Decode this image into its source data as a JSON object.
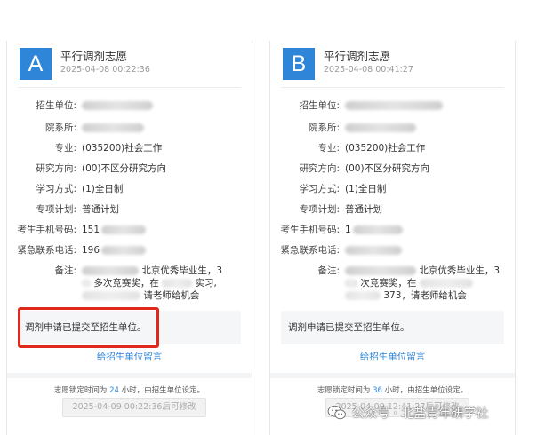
{
  "cards": [
    {
      "letter": "A",
      "title": "平行调剂志愿",
      "time": "2025-04-08 00:22:36",
      "labels": [
        "招生单位:",
        "院系所:",
        "专业:",
        "研究方向:",
        "学习方式:",
        "专项计划:",
        "考生手机号码:",
        "紧急联系电话:",
        "备注:"
      ],
      "major": "(035200)社会工作",
      "direction": "(00)不区分研究方向",
      "study_mode": "(1)全日制",
      "plan": "普通计划",
      "phone_prefix": "151",
      "emergency_prefix": "196",
      "remark_line1": "北京优秀毕业生，3",
      "remark_line2": "多次竞赛奖，在",
      "remark_line2b": "实习,",
      "remark_line3": "请老师给机会",
      "notice": "调剂申请已提交至招生单位。",
      "message_link": "给招生单位留言",
      "lock_prefix": "志愿锁定时间为",
      "lock_hours": "24",
      "lock_suffix": "小时，由招生单位设定。",
      "modify_button": "2025-04-09 00:22:36后可修改"
    },
    {
      "letter": "B",
      "title": "平行调剂志愿",
      "time": "2025-04-08 00:41:27",
      "labels": [
        "招生单位:",
        "院系所:",
        "专业:",
        "研究方向:",
        "学习方式:",
        "专项计划:",
        "考生手机号码:",
        "紧急联系电话:",
        "备注:"
      ],
      "major": "(035200)社会工作",
      "direction": "(00)不区分研究方向",
      "study_mode": "(1)全日制",
      "plan": "普通计划",
      "phone_prefix": "1",
      "emergency_prefix": "",
      "remark_line1": "北京优秀毕业生，3",
      "remark_line2": "次竞赛奖，在",
      "remark_line2b": "",
      "remark_line3": "373，请老师给机会",
      "notice": "调剂申请已提交至招生单位。",
      "message_link": "给招生单位留言",
      "lock_prefix": "志愿锁定时间为",
      "lock_hours": "36",
      "lock_suffix": "小时，由招生单位设定。",
      "modify_button": "2025-04-09 12:41:27后可修改"
    }
  ],
  "watermark": {
    "text": "公众号 · 北盐青年研学社",
    "icon": "wechat-icon"
  },
  "colors": {
    "accent": "#2f86d8",
    "highlight_border": "#e0281d"
  }
}
